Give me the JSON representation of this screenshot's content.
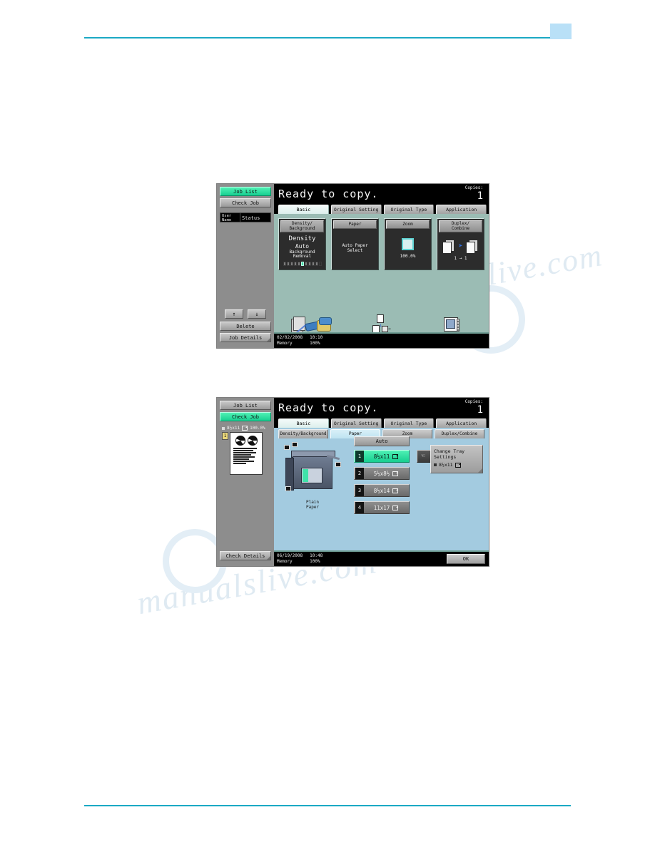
{
  "page": {
    "header_accent_color": "#1ba9c4",
    "header_box_color": "#b9e0f7",
    "watermark_1": "manualslive.com",
    "watermark_2": "manualslive.com"
  },
  "theme": {
    "accent_green": "#2fe0a0",
    "panel_green": "#9bbcb4",
    "panel_blue": "#a3cbe0",
    "bezel_gray": "#8d8d8d"
  },
  "panel_basic": {
    "title": "Ready to copy.",
    "copies_label": "Copies:",
    "copies_value": "1",
    "rail": {
      "job_list": "Job List",
      "check_job": "Check Job",
      "col_user": "User Name",
      "col_status": "Status",
      "arrow_up": "↑",
      "arrow_down": "↓",
      "delete": "Delete",
      "job_details": "Job Details"
    },
    "tabs": [
      {
        "label": "Basic",
        "active": true
      },
      {
        "label": "Original Setting",
        "active": false
      },
      {
        "label": "Original Type",
        "active": false
      },
      {
        "label": "Application",
        "active": false
      }
    ],
    "cards": [
      {
        "head_line1": "Density/",
        "head_line2": "Background",
        "value_1": "Density",
        "value_2": "Auto",
        "sub_line1": "Background",
        "sub_line2": "Removal",
        "scale_steps": 11,
        "scale_selected": 6
      },
      {
        "head_line1": "Paper",
        "head_line2": "",
        "value_1": "Auto Paper",
        "value_2": "Select"
      },
      {
        "head_line1": "Zoom",
        "head_line2": "",
        "value_1": "100.0%"
      },
      {
        "head_line1": "Duplex/",
        "head_line2": "Combine",
        "value_1": "1  →  1"
      }
    ],
    "functions": [
      {
        "label": "Finishing",
        "icon": "finishing-icon"
      },
      {
        "label": "Separate Scan",
        "icon": "separate-scan-icon"
      },
      {
        "label": "Auto Rotate OFF",
        "icon": "auto-rotate-icon"
      }
    ],
    "status": {
      "date": "02/02/2008",
      "time": "10:10",
      "memory_label": "Memory",
      "memory_value": "100%"
    }
  },
  "panel_paper": {
    "title": "Ready to copy.",
    "copies_label": "Copies:",
    "copies_value": "1",
    "rail": {
      "job_list": "Job List",
      "check_job": "Check Job",
      "preview_size": "8½x11",
      "preview_zoom": "100.0%",
      "preview_page_number": "1",
      "check_details": "Check Details"
    },
    "tabs": [
      {
        "label": "Basic",
        "active": true
      },
      {
        "label": "Original Setting",
        "active": false
      },
      {
        "label": "Original Type",
        "active": false
      },
      {
        "label": "Application",
        "active": false
      }
    ],
    "subtabs": [
      {
        "line1": "Density/",
        "line2": "Background",
        "active": false
      },
      {
        "line1": "Paper",
        "line2": "",
        "active": true
      },
      {
        "line1": "Zoom",
        "line2": "",
        "active": false
      },
      {
        "line1": "Duplex/",
        "line2": "Combine",
        "active": false
      }
    ],
    "printer_label_line1": "Plain",
    "printer_label_line2": "Paper",
    "auto_button": "Auto",
    "trays": [
      {
        "number": "1",
        "size": "8½x11",
        "selected": true
      },
      {
        "number": "2",
        "size": "5½x8½",
        "selected": false
      },
      {
        "number": "3",
        "size": "8½x14",
        "selected": false
      },
      {
        "number": "4",
        "size": "11x17",
        "selected": false
      }
    ],
    "bypass": {
      "size": "8½x11",
      "icon": "hand-feed-icon"
    },
    "change_tray": {
      "line1": "Change Tray",
      "line2": "Settings",
      "line3": "8½x11"
    },
    "ok_button": "OK",
    "status": {
      "date": "06/19/2008",
      "time": "10:48",
      "memory_label": "Memory",
      "memory_value": "100%"
    }
  }
}
